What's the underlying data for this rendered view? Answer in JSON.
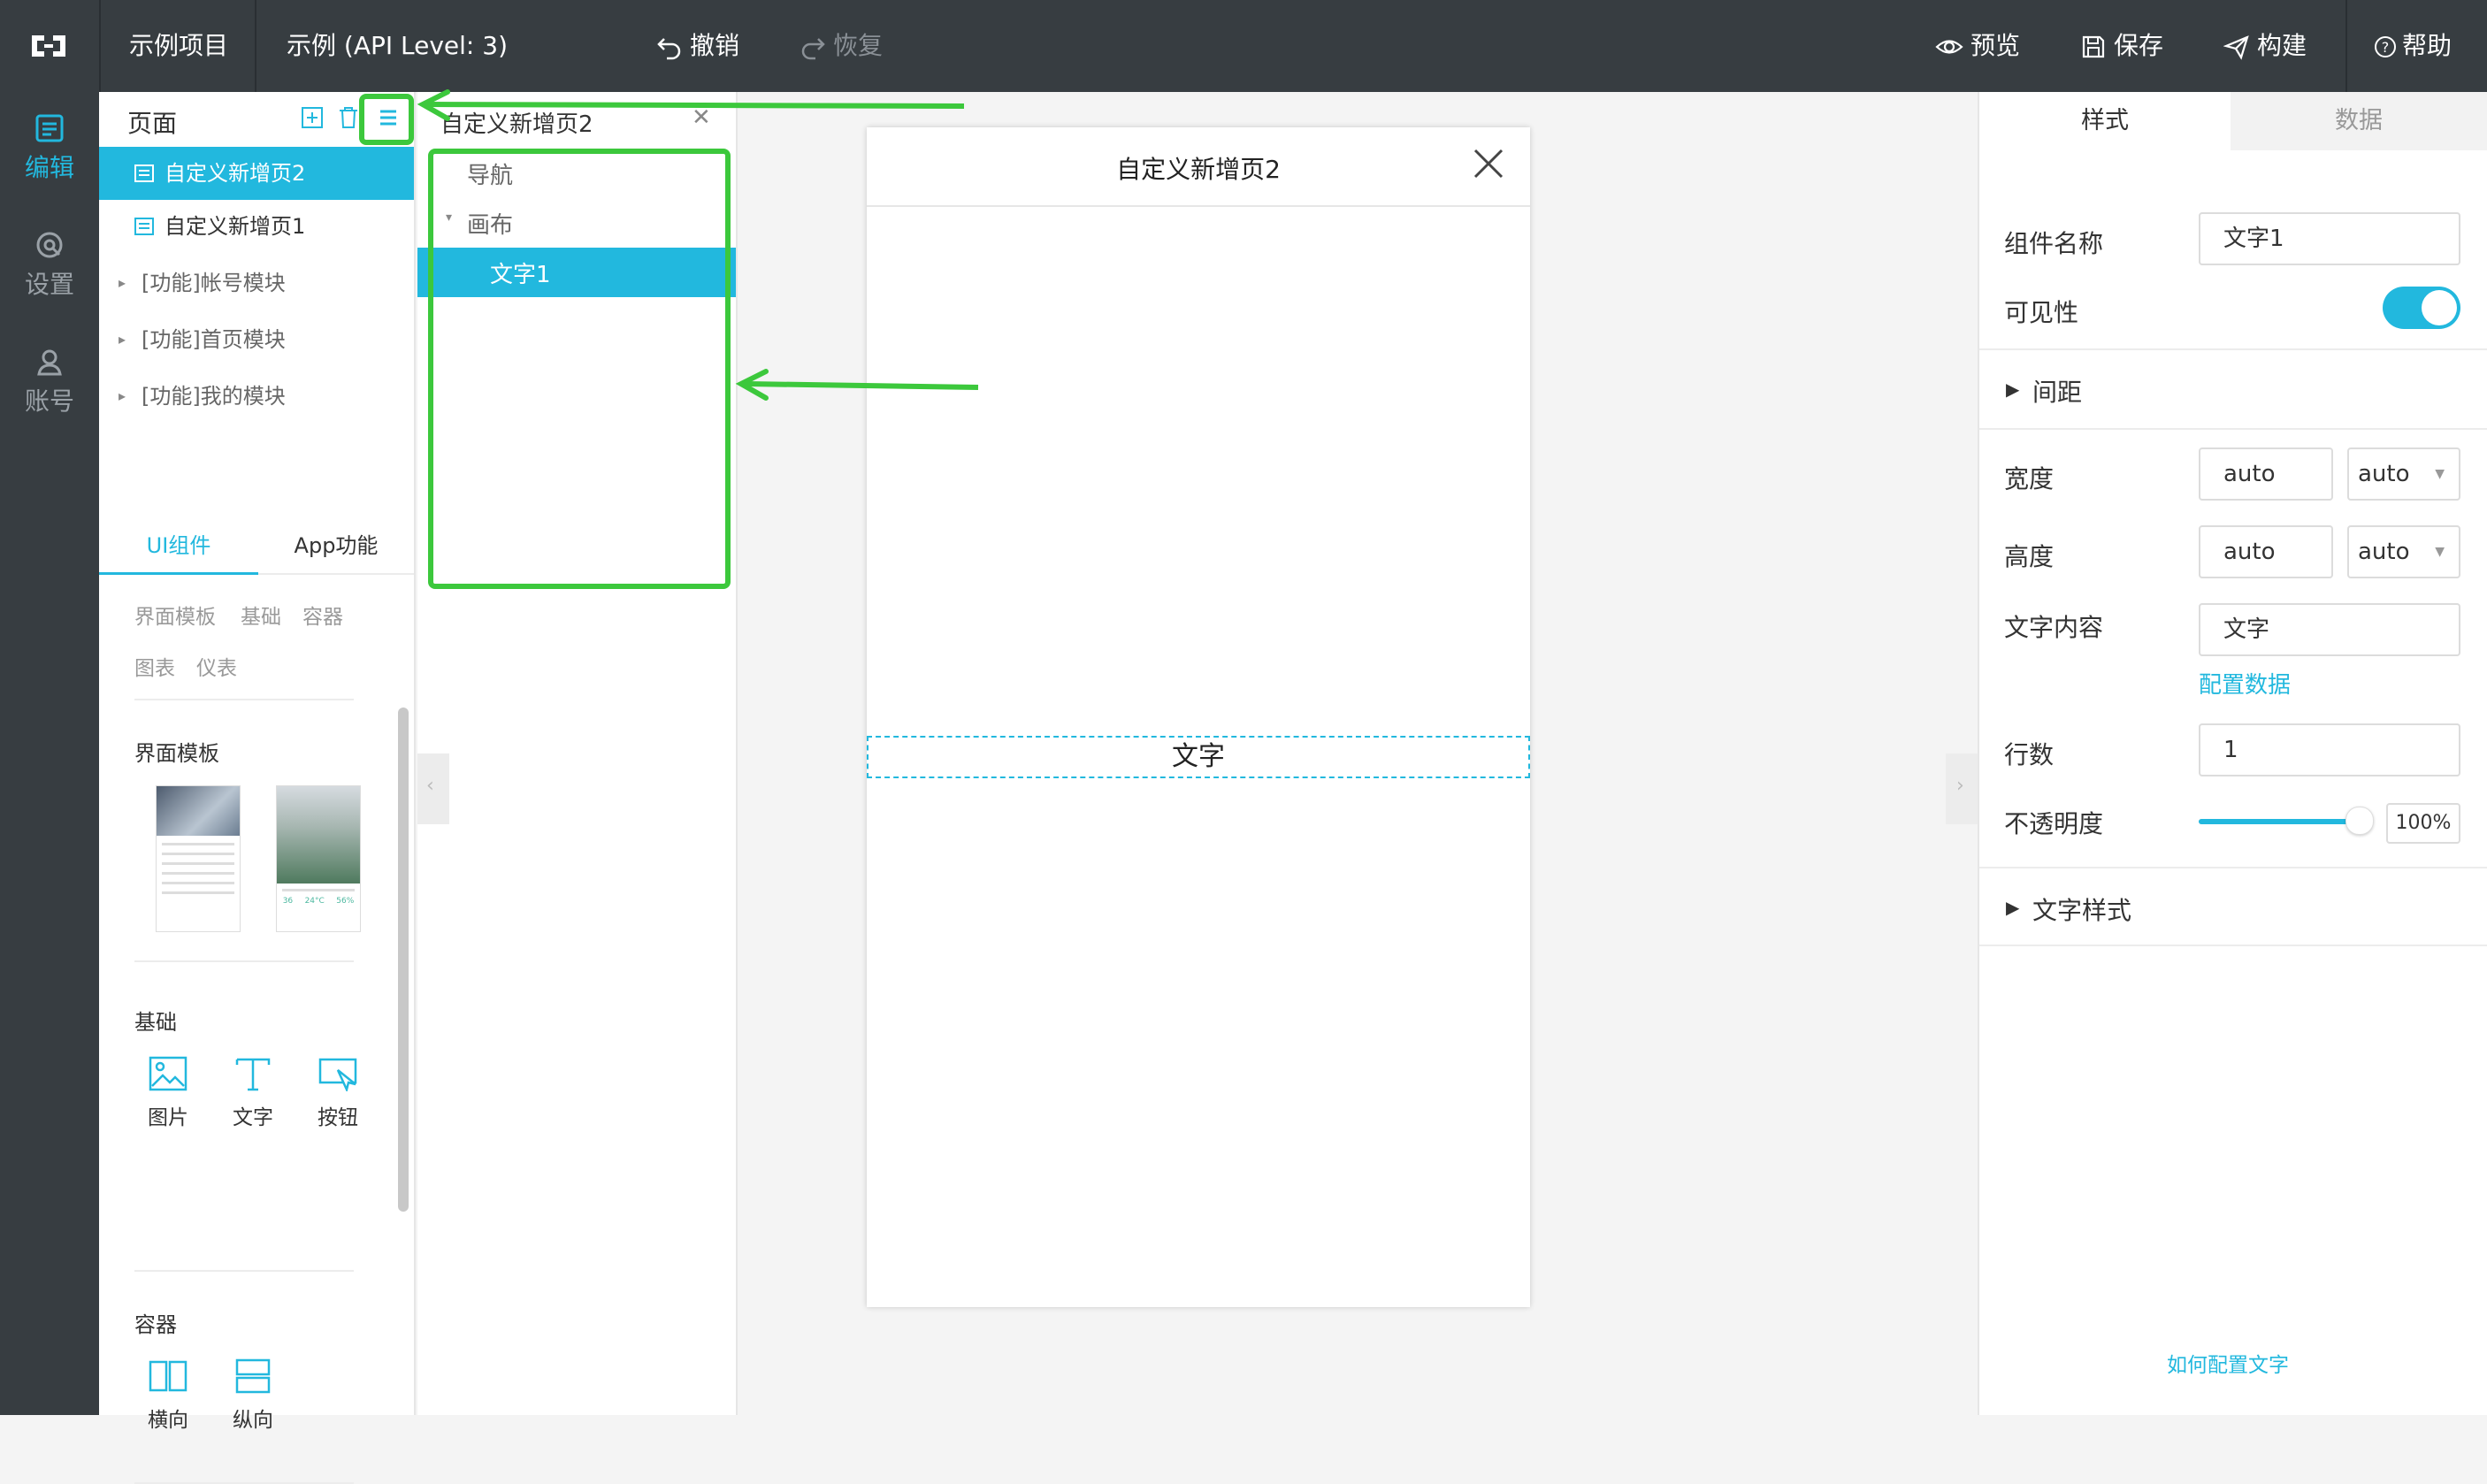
{
  "topbar": {
    "project": "示例项目",
    "api": "示例 (API Level: 3)",
    "undo": "撤销",
    "redo": "恢复",
    "preview": "预览",
    "save": "保存",
    "build": "构建",
    "help": "帮助"
  },
  "leftnav": [
    {
      "label": "编辑",
      "icon": "edit-icon"
    },
    {
      "label": "设置",
      "icon": "settings-icon"
    },
    {
      "label": "账号",
      "icon": "account-icon"
    }
  ],
  "pages": {
    "title": "页面",
    "items": [
      "自定义新增页2",
      "自定义新增页1"
    ],
    "modules": [
      "[功能]帐号模块",
      "[功能]首页模块",
      "[功能]我的模块"
    ]
  },
  "components": {
    "tabs": [
      "UI组件",
      "App功能"
    ],
    "filters": [
      "界面模板",
      "基础",
      "容器",
      "图表",
      "仪表"
    ],
    "section_templates": "界面模板",
    "template_preview": {
      "values": [
        "36",
        "24°C",
        "56%"
      ]
    },
    "section_basic": "基础",
    "basic_items": [
      "图片",
      "文字",
      "按钮"
    ],
    "section_container": "容器",
    "container_items": [
      "横向",
      "纵向"
    ]
  },
  "tree": {
    "title": "自定义新增页2",
    "nav": "导航",
    "canvas": "画布",
    "selected": "文字1"
  },
  "phone": {
    "title": "自定义新增页2",
    "text": "文字"
  },
  "props": {
    "tabs": [
      "样式",
      "数据"
    ],
    "name_label": "组件名称",
    "name_value": "文字1",
    "visible_label": "可见性",
    "visible": true,
    "spacing": "间距",
    "width_label": "宽度",
    "width_value": "auto",
    "width_unit": "auto",
    "height_label": "高度",
    "height_value": "auto",
    "height_unit": "auto",
    "text_label": "文字内容",
    "text_value": "文字",
    "config_link": "配置数据",
    "lines_label": "行数",
    "lines_value": "1",
    "opacity_label": "不透明度",
    "opacity_value": "100%",
    "opacity_level": 1.0,
    "text_style": "文字样式",
    "help_link": "如何配置文字"
  },
  "colors": {
    "accent": "#22b8de",
    "topbar": "#373d41",
    "annotation": "#3cc83c"
  }
}
